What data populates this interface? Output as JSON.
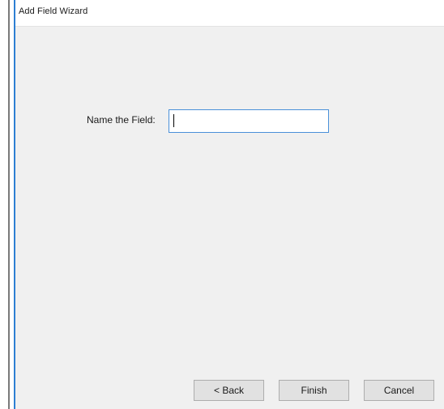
{
  "window": {
    "title": "Add Field Wizard"
  },
  "form": {
    "field_label": "Name the Field:",
    "name_value": "",
    "name_placeholder": ""
  },
  "buttons": {
    "back_label": "< Back",
    "finish_label": "Finish",
    "cancel_label": "Cancel"
  },
  "colors": {
    "accent": "#2d7fd3",
    "window_background": "#f0f0f0",
    "input_border": "#4a90d9",
    "button_background": "#e1e1e1"
  }
}
